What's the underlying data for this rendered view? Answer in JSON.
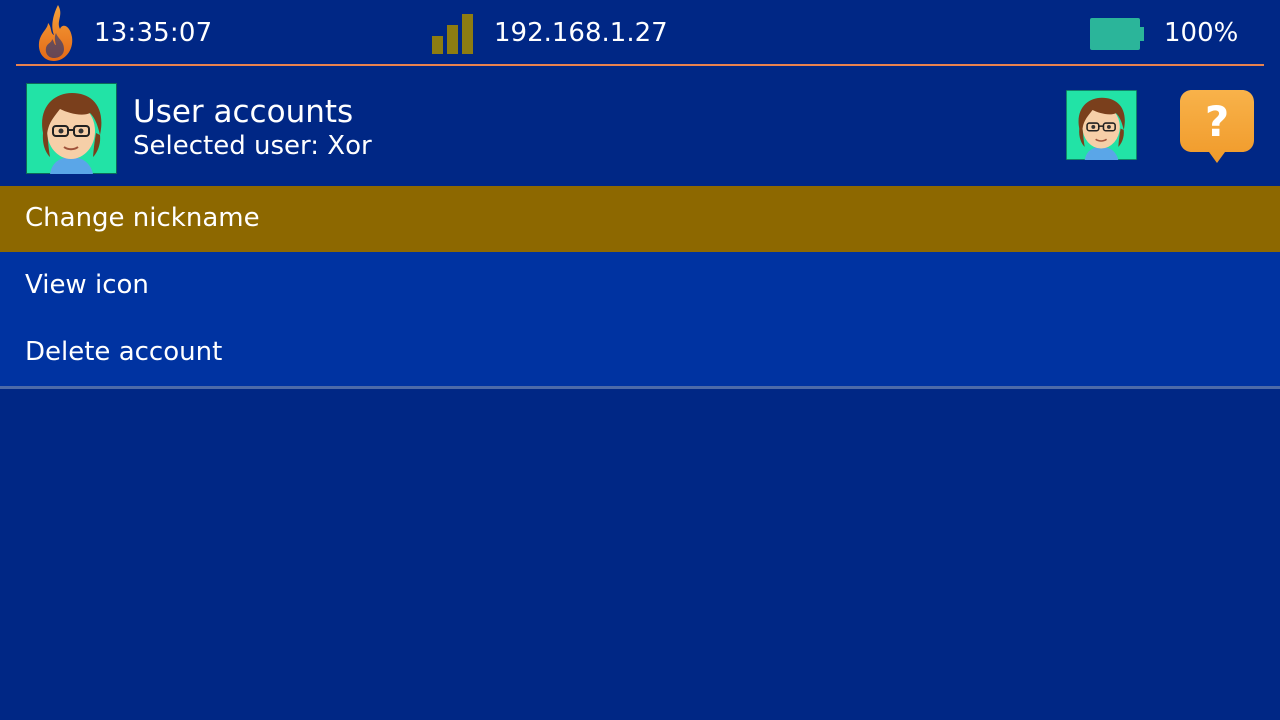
{
  "statusbar": {
    "time": "13:35:07",
    "ip_address": "192.168.1.27",
    "battery_percent": "100%",
    "battery_level": 1.0,
    "signal_bars_active": 3,
    "logo_icon": "flame-icon",
    "signal_icon": "signal-strength-icon",
    "battery_icon": "battery-icon",
    "divider_color": "#e8824e"
  },
  "header": {
    "title": "User accounts",
    "subtitle": "Selected user: Xor",
    "avatar_icon": "user-avatar-icon",
    "help_icon": "question-mark-icon"
  },
  "menu": {
    "items": [
      {
        "label": "Change nickname",
        "selected": true
      },
      {
        "label": "View icon",
        "selected": false
      },
      {
        "label": "Delete account",
        "selected": false
      }
    ]
  },
  "colors": {
    "background": "#002785",
    "menu_background": "#0033a1",
    "selected_item": "#8d6800",
    "help_badge": "#f5a638",
    "battery": "#2bb59a",
    "signal": "#8d7c11"
  }
}
